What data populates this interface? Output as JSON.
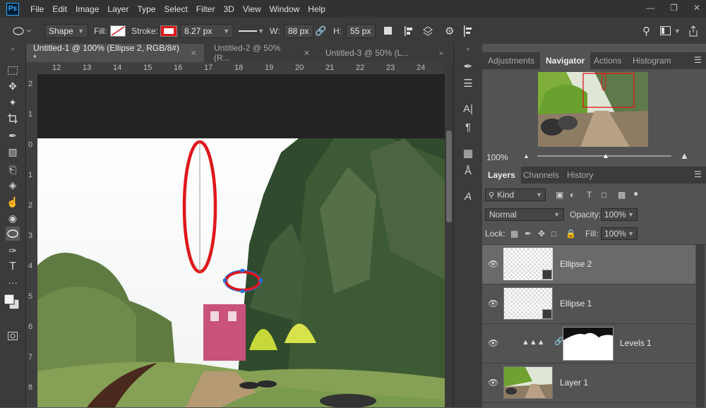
{
  "menu": [
    "File",
    "Edit",
    "Image",
    "Layer",
    "Type",
    "Select",
    "Filter",
    "3D",
    "View",
    "Window",
    "Help"
  ],
  "app_logo": "Ps",
  "options": {
    "tool_mode": "Shape",
    "fill_label": "Fill:",
    "stroke_label": "Stroke:",
    "stroke_width": "8.27 px",
    "w_label": "W:",
    "w_value": "88 px",
    "h_label": "H:",
    "h_value": "55 px"
  },
  "tabs": [
    {
      "label": "Untitled-1 @ 100% (Ellipse 2, RGB/8#) *"
    },
    {
      "label": "Untitled-2 @ 50% (R..."
    },
    {
      "label": "Untitled-3 @ 50% (L..."
    }
  ],
  "ruler_h": [
    "12",
    "13",
    "14",
    "15",
    "16",
    "17",
    "18",
    "19",
    "20",
    "21",
    "22",
    "23",
    "24"
  ],
  "ruler_v": [
    "2",
    "1",
    "0",
    "1",
    "2",
    "3",
    "4",
    "5",
    "6",
    "7",
    "8"
  ],
  "top_panel_tabs": [
    "Adjustments",
    "Navigator",
    "Actions",
    "Histogram"
  ],
  "navigator": {
    "zoom": "100%"
  },
  "layer_panel_tabs": [
    "Layers",
    "Channels",
    "History"
  ],
  "layers_controls": {
    "filter_kind": "Kind",
    "blend_mode": "Normal",
    "opacity_label": "Opacity:",
    "opacity_value": "100%",
    "lock_label": "Lock:",
    "fill_label": "Fill:",
    "fill_value": "100%"
  },
  "layers": [
    {
      "name": "Ellipse 2",
      "selected": true
    },
    {
      "name": "Ellipse 1",
      "selected": false
    },
    {
      "name": "Levels 1",
      "selected": false
    },
    {
      "name": "Layer 1",
      "selected": false
    }
  ],
  "colors": {
    "accent_red": "#e0161b",
    "selection_blue": "#1f6fd6"
  }
}
